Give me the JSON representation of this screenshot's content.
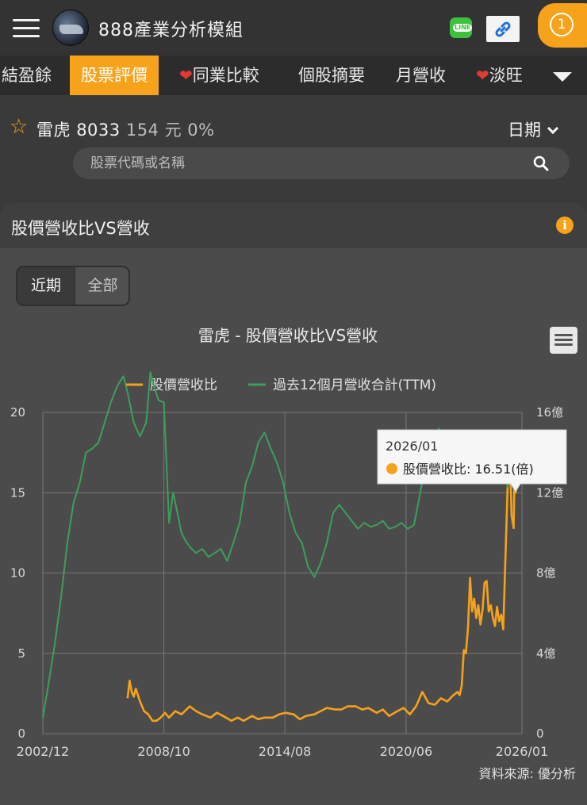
{
  "app": {
    "title": "888產業分析模組",
    "notify_count": "1"
  },
  "tabs": [
    {
      "label": "結盈餘",
      "heart": false,
      "active": false
    },
    {
      "label": "股票評價",
      "heart": false,
      "active": true
    },
    {
      "label": "同業比較",
      "heart": true,
      "active": false
    },
    {
      "label": "個股摘要",
      "heart": false,
      "active": false
    },
    {
      "label": "月營收",
      "heart": false,
      "active": false
    },
    {
      "label": "淡旺",
      "heart": true,
      "active": false
    }
  ],
  "stock": {
    "name": "雷虎",
    "code": "8033",
    "price": "154 元",
    "change": "0%"
  },
  "date_selector": "日期",
  "search": {
    "placeholder": "股票代碼或名稱"
  },
  "panel": {
    "title": "股價營收比VS營收",
    "range_buttons": [
      "近期",
      "全部"
    ],
    "source": "資料來源: 優分析"
  },
  "colors": {
    "accent": "#f6a21a",
    "psr": "#f5a21b",
    "revenue": "#3e9e5c"
  },
  "chart_data": {
    "type": "line",
    "title": "雷虎 - 股價營收比VS營收",
    "legend_placement": "top",
    "grid": true,
    "x_tick_labels": [
      "2002/12",
      "2008/10",
      "2014/08",
      "2020/06",
      "2026/01"
    ],
    "x_tick_years": [
      2002.92,
      2008.75,
      2014.58,
      2020.42,
      2026.0
    ],
    "xlim": [
      2002.92,
      2026.0
    ],
    "y_left_ticks": [
      "0",
      "5",
      "10",
      "15",
      "20"
    ],
    "y_left_lim": [
      0,
      20
    ],
    "y_right_ticks": [
      "0",
      "4億",
      "8億",
      "12億",
      "16億"
    ],
    "y_right_lim": [
      0,
      16
    ],
    "series": [
      {
        "name": "股價營收比",
        "axis": "left",
        "x": [
          2007.0,
          2007.1,
          2007.2,
          2007.3,
          2007.4,
          2007.6,
          2007.8,
          2008.0,
          2008.2,
          2008.4,
          2008.6,
          2008.8,
          2009.0,
          2009.3,
          2009.6,
          2010.0,
          2010.3,
          2010.6,
          2011.0,
          2011.3,
          2011.6,
          2012.0,
          2012.3,
          2012.6,
          2013.0,
          2013.3,
          2013.6,
          2014.0,
          2014.3,
          2014.6,
          2015.0,
          2015.3,
          2015.6,
          2016.0,
          2016.3,
          2016.6,
          2017.0,
          2017.3,
          2017.6,
          2018.0,
          2018.3,
          2018.6,
          2019.0,
          2019.3,
          2019.6,
          2020.0,
          2020.3,
          2020.6,
          2020.9,
          2021.2,
          2021.5,
          2021.8,
          2022.1,
          2022.4,
          2022.7,
          2022.9,
          2023.0,
          2023.1,
          2023.2,
          2023.3,
          2023.4,
          2023.5,
          2023.6,
          2023.7,
          2023.8,
          2023.9,
          2024.0,
          2024.1,
          2024.2,
          2024.3,
          2024.4,
          2024.5,
          2024.6,
          2024.7,
          2024.8,
          2024.9,
          2025.0,
          2025.1,
          2025.2,
          2025.3,
          2025.4,
          2025.5,
          2025.6,
          2025.65,
          2025.7,
          2025.75,
          2025.8,
          2025.9,
          2026.0
        ],
        "values": [
          2.2,
          3.3,
          2.6,
          2.3,
          2.8,
          2.0,
          1.4,
          1.2,
          0.8,
          0.8,
          1.0,
          1.3,
          1.0,
          1.4,
          1.2,
          1.7,
          1.4,
          1.2,
          1.0,
          1.3,
          1.1,
          0.8,
          1.0,
          0.8,
          1.1,
          0.9,
          1.0,
          1.0,
          1.2,
          1.3,
          1.2,
          0.9,
          1.1,
          1.2,
          1.4,
          1.6,
          1.5,
          1.5,
          1.7,
          1.7,
          1.5,
          1.6,
          1.3,
          1.5,
          1.1,
          1.4,
          1.6,
          1.2,
          1.7,
          2.6,
          1.9,
          1.8,
          2.2,
          2.0,
          2.4,
          2.6,
          2.4,
          3.0,
          5.2,
          5.0,
          6.6,
          9.7,
          7.6,
          8.4,
          7.2,
          8.0,
          6.8,
          7.7,
          9.4,
          9.5,
          7.6,
          8.0,
          7.2,
          6.7,
          7.9,
          7.0,
          7.4,
          6.5,
          10.8,
          15.0,
          18.3,
          13.6,
          12.8,
          16.5,
          15.0,
          16.51,
          16.51,
          16.51,
          16.51
        ]
      },
      {
        "name": "過去12個月營收合計(TTM)",
        "axis": "right",
        "x": [
          2002.92,
          2003.2,
          2003.5,
          2003.8,
          2004.1,
          2004.4,
          2004.7,
          2005.0,
          2005.3,
          2005.6,
          2005.9,
          2006.2,
          2006.5,
          2006.8,
          2007.0,
          2007.3,
          2007.6,
          2007.9,
          2008.1,
          2008.3,
          2008.5,
          2008.75,
          2009.0,
          2009.2,
          2009.4,
          2009.6,
          2009.8,
          2010.0,
          2010.3,
          2010.6,
          2010.9,
          2011.2,
          2011.5,
          2011.8,
          2012.1,
          2012.4,
          2012.7,
          2013.0,
          2013.3,
          2013.6,
          2013.9,
          2014.2,
          2014.5,
          2014.8,
          2015.1,
          2015.4,
          2015.7,
          2016.0,
          2016.3,
          2016.6,
          2016.9,
          2017.2,
          2017.5,
          2017.8,
          2018.1,
          2018.4,
          2018.7,
          2019.0,
          2019.3,
          2019.6,
          2019.9,
          2020.2,
          2020.5,
          2020.8,
          2021.1,
          2021.4,
          2021.7,
          2022.0,
          2022.3,
          2022.6,
          2022.9,
          2023.2,
          2023.5,
          2023.8,
          2024.1,
          2024.4,
          2024.7,
          2025.0,
          2025.3,
          2025.6,
          2025.8,
          2026.0
        ],
        "values": [
          0.8,
          2.5,
          4.5,
          6.8,
          9.5,
          11.5,
          12.5,
          14.0,
          14.2,
          14.5,
          15.5,
          16.5,
          17.3,
          17.8,
          17.0,
          15.5,
          14.8,
          15.5,
          18.0,
          17.2,
          16.6,
          16.5,
          10.5,
          12.0,
          11.0,
          10.0,
          9.6,
          9.3,
          9.0,
          9.2,
          8.8,
          9.0,
          9.2,
          8.6,
          9.5,
          10.5,
          12.5,
          13.3,
          14.5,
          15.0,
          14.2,
          13.5,
          12.5,
          11.0,
          10.0,
          9.5,
          8.3,
          7.8,
          8.5,
          9.5,
          11.0,
          11.4,
          11.0,
          10.6,
          10.2,
          10.5,
          10.3,
          10.4,
          10.6,
          10.2,
          10.3,
          10.5,
          10.2,
          10.4,
          12.0,
          13.8,
          14.5,
          15.2,
          14.0,
          14.3,
          13.8,
          14.3,
          13.5,
          14.0,
          13.2,
          12.8,
          13.9,
          14.5,
          12.3,
          12.8,
          14.3,
          14.5
        ]
      }
    ],
    "tooltip": {
      "date": "2026/01",
      "series": "股價營收比",
      "text": "股價營收比: 16.51(倍)",
      "value": 16.51
    }
  }
}
